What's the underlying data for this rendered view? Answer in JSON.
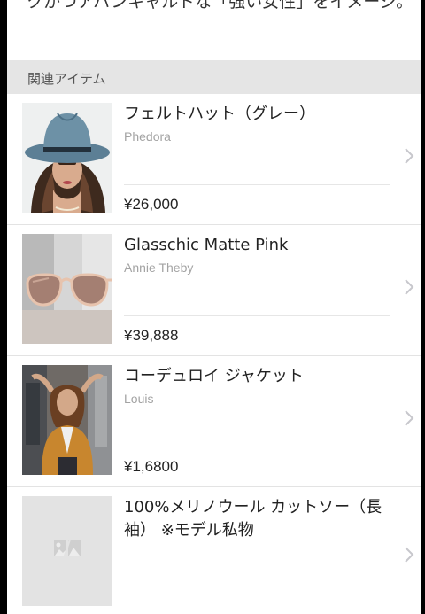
{
  "intro_text": "クかつアバンギャルドな「強い女性」をイメージ。",
  "section_label": "関連アイテム",
  "items": [
    {
      "title": "フェルトハット（グレー）",
      "brand": "Phedora",
      "price": "¥26,000",
      "thumb_icon": "hat-woman-photo"
    },
    {
      "title": "Glasschic Matte Pink",
      "brand": "Annie Theby",
      "price": "¥39,888",
      "thumb_icon": "sunglasses-photo"
    },
    {
      "title": "コーデュロイ ジャケット",
      "brand": "Louis",
      "price": "¥1,6800",
      "thumb_icon": "jacket-woman-photo"
    },
    {
      "title": "100%メリノウール カットソー（長袖） ※モデル私物",
      "brand": "",
      "price": "",
      "thumb_icon": "image-placeholder-icon"
    }
  ],
  "colors": {
    "section_bg": "#e5e5e5",
    "brand_gray": "#a3a3a3",
    "chevron": "#c7c7cc"
  }
}
